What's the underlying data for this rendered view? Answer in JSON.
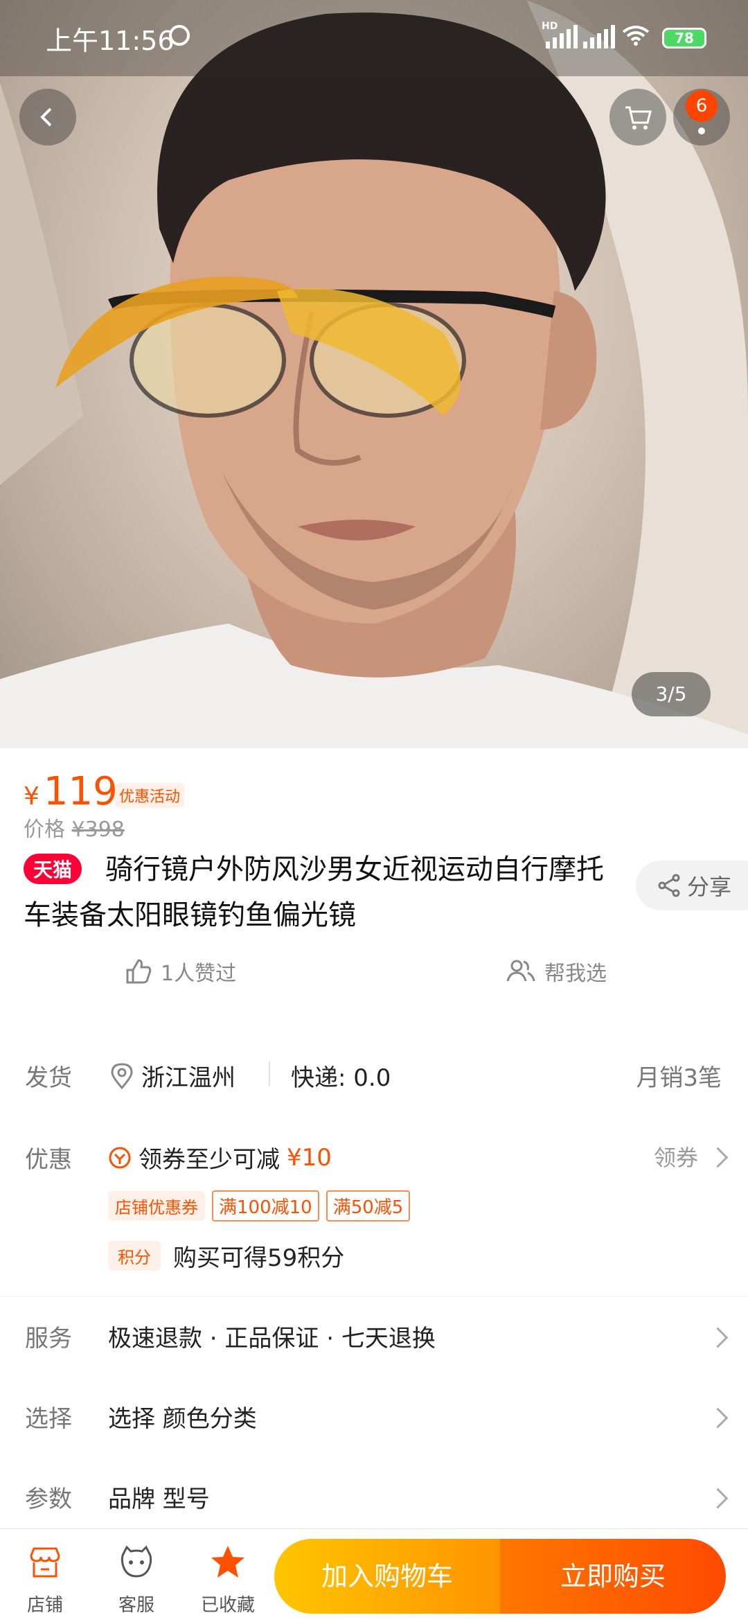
{
  "status": {
    "time": "上午11:56",
    "battery": "78",
    "hd": "HD"
  },
  "gallery": {
    "counter": "3/5",
    "cart_badge": "6"
  },
  "product": {
    "price_symbol": "¥",
    "price": "119",
    "promo_label": "优惠活动",
    "original_label": "价格",
    "original_price": "¥398",
    "tmall_badge": "天猫",
    "title": "骑行镜户外防风沙男女近视运动自行摩托车装备太阳眼镜钓鱼偏光镜",
    "share_label": "分享",
    "likes_label": "1人赞过",
    "helpme_label": "帮我选"
  },
  "shipping": {
    "label": "发货",
    "location": "浙江温州",
    "express": "快递: 0.0",
    "monthly_sales": "月销3笔"
  },
  "discount": {
    "label": "优惠",
    "coupon_text": "领券至少可减",
    "coupon_amount": "¥10",
    "get_coupon": "领券",
    "store_tag": "店铺优惠券",
    "tiers": [
      "满100减10",
      "满50减5"
    ],
    "points_tag": "积分",
    "points_text": "购买可得59积分"
  },
  "service": {
    "label": "服务",
    "value": "极速退款 · 正品保证 · 七天退换",
    "select_label": "选择",
    "select_value": "选择 颜色分类",
    "params_label": "参数",
    "params_value": "品牌 型号"
  },
  "bottom": {
    "store": "店铺",
    "service": "客服",
    "favorited": "已收藏",
    "add_cart": "加入购物车",
    "buy_now": "立即购买"
  },
  "colors": {
    "accent": "#ff5000",
    "tmall": "#ff0036"
  }
}
